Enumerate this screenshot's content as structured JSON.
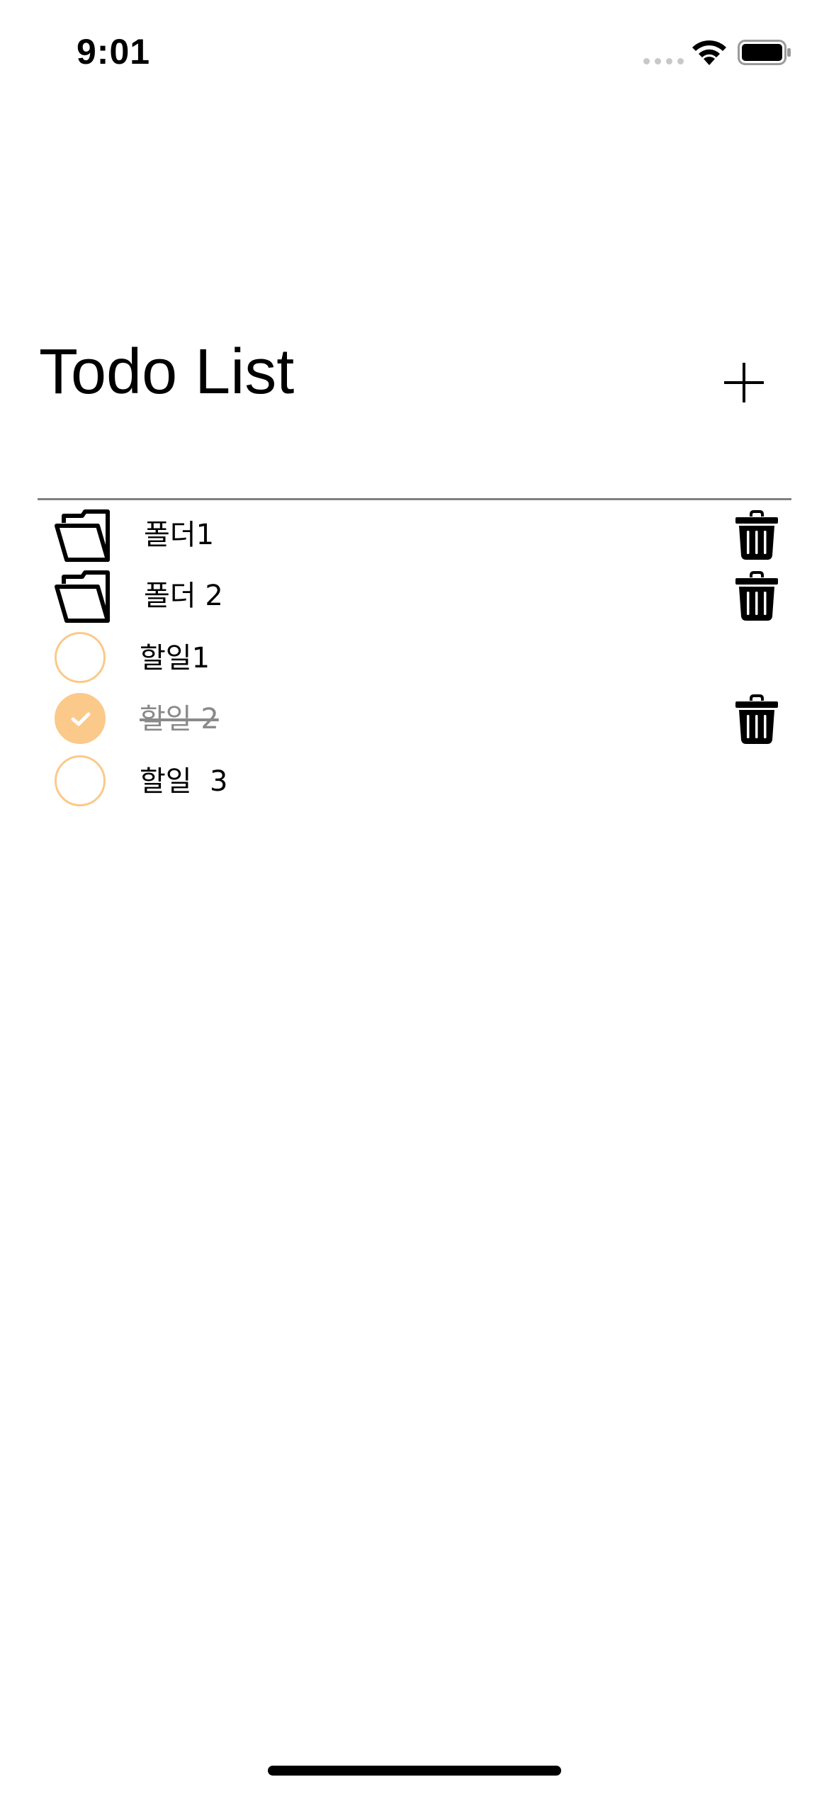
{
  "status_bar": {
    "time": "9:01"
  },
  "header": {
    "title": "Todo List",
    "add_icon": "plus-icon"
  },
  "items": [
    {
      "type": "folder",
      "label": "폴더1",
      "icon": "folder-icon",
      "deletable": true
    },
    {
      "type": "folder",
      "label": "폴더 2",
      "icon": "folder-icon",
      "deletable": true
    },
    {
      "type": "todo",
      "label": "할일1",
      "checked": false,
      "deletable": false
    },
    {
      "type": "todo",
      "label": "할일 2",
      "checked": true,
      "deletable": true
    },
    {
      "type": "todo",
      "label": "할일  3",
      "checked": false,
      "deletable": false
    }
  ],
  "colors": {
    "accent": "#fbc98a",
    "divider": "#808080",
    "done_text": "#8a8a8a"
  }
}
